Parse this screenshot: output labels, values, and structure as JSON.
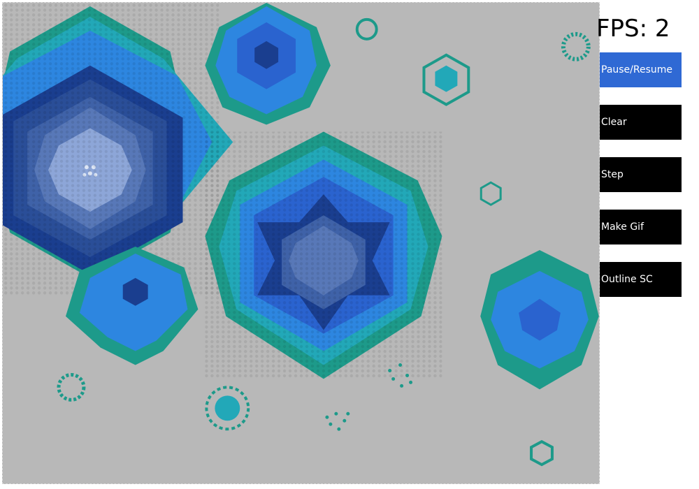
{
  "fps": {
    "label": "FPS: ",
    "value": "2",
    "text": "FPS: 2"
  },
  "buttons": [
    {
      "id": "pause",
      "label": "Pause/Resume",
      "color": "#2f69d4"
    },
    {
      "id": "clear",
      "label": "Clear",
      "color": "#000000"
    },
    {
      "id": "step",
      "label": "Step",
      "color": "#000000"
    },
    {
      "id": "gif",
      "label": "Make Gif",
      "color": "#000000"
    },
    {
      "id": "outline",
      "label": "Outline SC",
      "color": "#000000"
    }
  ],
  "canvas": {
    "background": "#b8b8b8",
    "palette": {
      "teal": "#1d9a8a",
      "cyan": "#22a8b8",
      "sky": "#2d86e0",
      "blue": "#2a63cf",
      "navy": "#1a3e8f",
      "slate": "#3f62a8",
      "steel": "#5878b8",
      "pale": "#8da6d8",
      "white": "#dde6f5"
    }
  }
}
